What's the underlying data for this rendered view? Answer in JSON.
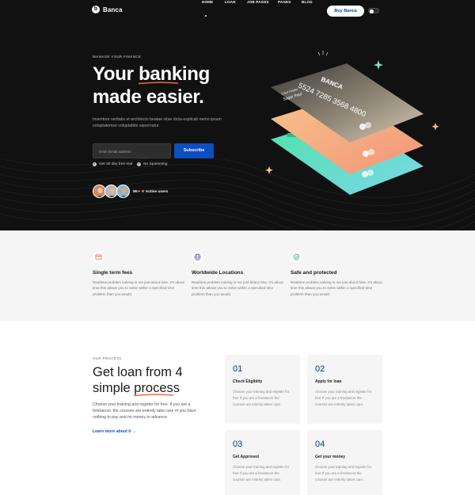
{
  "nav": {
    "logo_mark": "b",
    "logo_text": "Banca",
    "links": [
      "HOME",
      "LOAN",
      "JOB PAGES",
      "PAGES",
      "BLOG"
    ],
    "cta_label": "Buy Banca"
  },
  "hero": {
    "eyebrow": "MANAGE YOUR FINANCE",
    "title_part1": "Your ",
    "title_highlight": "banking",
    "title_line2": "made easier.",
    "description": "Inventore veritatis et architecto beatae vitae dicta explicab nemo ipsam voluptatemse voluptatble aspernatur.",
    "email_placeholder": "Enter Email address",
    "subscribe_label": "Subscribe",
    "checks": [
      "Get 30 day free trial",
      "No Spamming"
    ],
    "users_count": "5K+",
    "users_star": "★",
    "users_label": "Active users",
    "card_brand": "BANCA",
    "card_number": "5524 7285 3568 4800",
    "card_holder_label": "Card Holder",
    "card_holder_name": "Sagar Paul"
  },
  "features": [
    {
      "icon": "card-icon",
      "title": "Single term fees",
      "desc": "Realtime problem solving is not just about time, it's about time this allows you to solve within a specified time problem than you would."
    },
    {
      "icon": "globe-icon",
      "title": "Worldwide Locations",
      "desc": "Realtime problem solving is not just about time, it's about time this allows you to solve within a specified time problem than you would."
    },
    {
      "icon": "shield-icon",
      "title": "Safe and protected",
      "desc": "Realtime problem solving is not just about time, it's about time this allows you to solve within a specified time problem than you would."
    }
  ],
  "process": {
    "eyebrow": "OUR PROCESS",
    "title_line1": "Get loan from 4",
    "title_part2": "simple ",
    "title_highlight": "process",
    "description": "Choose your training and register for free. If you are a freelancer, the courses are entirely take care of you have nothing to pay and no money to advance.",
    "learn_more": "Learn more about it →",
    "steps": [
      {
        "num": "01",
        "title": "Check Eligiblity",
        "desc": "Choose your training and register for free If you are a freelancer the courses are entirely taken care."
      },
      {
        "num": "02",
        "title": "Apply for loan",
        "desc": "Choose your training and register for free If you are a freelancer the courses are entirely taken care."
      },
      {
        "num": "03",
        "title": "Get Approved",
        "desc": "Choose your training and register for free If you are a freelancer the courses are entirely taken care."
      },
      {
        "num": "04",
        "title": "Get your money",
        "desc": "Choose your training and register for free If you are a freelancer the courses are entirely taken care."
      }
    ]
  },
  "colors": {
    "hero_bg": "#111111",
    "accent_orange": "#f2694a",
    "brand_blue": "#0b4fc2",
    "section_gray": "#f5f5f5"
  }
}
